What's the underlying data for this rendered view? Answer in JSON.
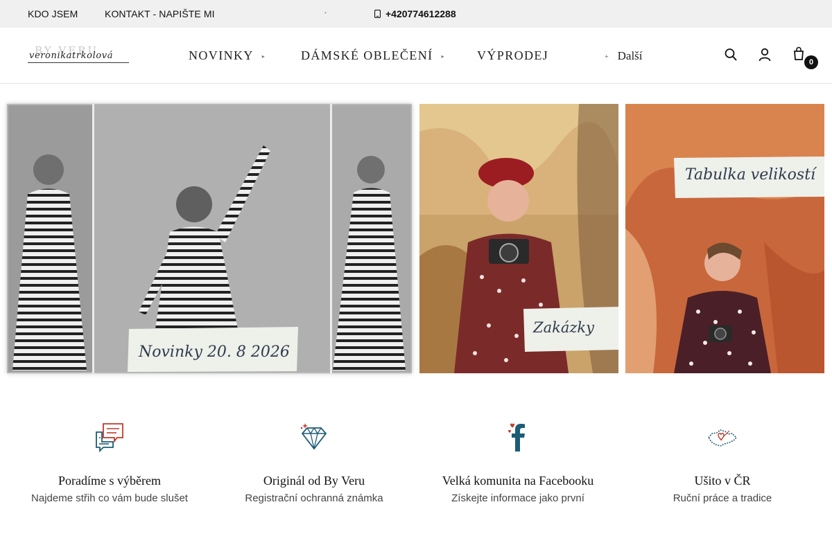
{
  "topbar": {
    "links": [
      "KDO JSEM",
      "KONTAKT - NAPIŠTE MI"
    ],
    "phone": "+420774612288",
    "icons": [
      "dot-icon",
      "phone-icon"
    ]
  },
  "header": {
    "logo": {
      "ghost_text": "BY VERU",
      "script_text": "veronikatrkolová"
    },
    "nav": [
      {
        "label": "NOVINKY",
        "has_dropdown": true
      },
      {
        "label": "DÁMSKÉ OBLEČENÍ",
        "has_dropdown": true
      },
      {
        "label": "VÝPRODEJ",
        "has_dropdown": false
      }
    ],
    "more_label": "Další",
    "icons": [
      "search-icon",
      "user-icon",
      "cart-icon"
    ],
    "cart_count": "0"
  },
  "banners": [
    {
      "label": "Novinky 20. 8 2026"
    },
    {
      "label": "Zakázky"
    },
    {
      "label": "Tabulka velikostí"
    }
  ],
  "features": [
    {
      "icon": "chat-icon",
      "title": "Poradíme s výběrem",
      "subtitle": "Najdeme střih co vám bude slušet"
    },
    {
      "icon": "diamond-icon",
      "title": "Originál od By Veru",
      "subtitle": "Registrační ochranná známka"
    },
    {
      "icon": "facebook-icon",
      "title": "Velká komunita na Facebooku",
      "subtitle": "Získejte informace jako první"
    },
    {
      "icon": "czech-map-icon",
      "title": "Ušito v ČR",
      "subtitle": "Ruční práce a tradice"
    }
  ],
  "colors": {
    "accent_teal": "#1d5c74",
    "accent_red": "#c0392b",
    "topbar_bg": "#f0f0f0",
    "badge_bg": "#111111"
  }
}
